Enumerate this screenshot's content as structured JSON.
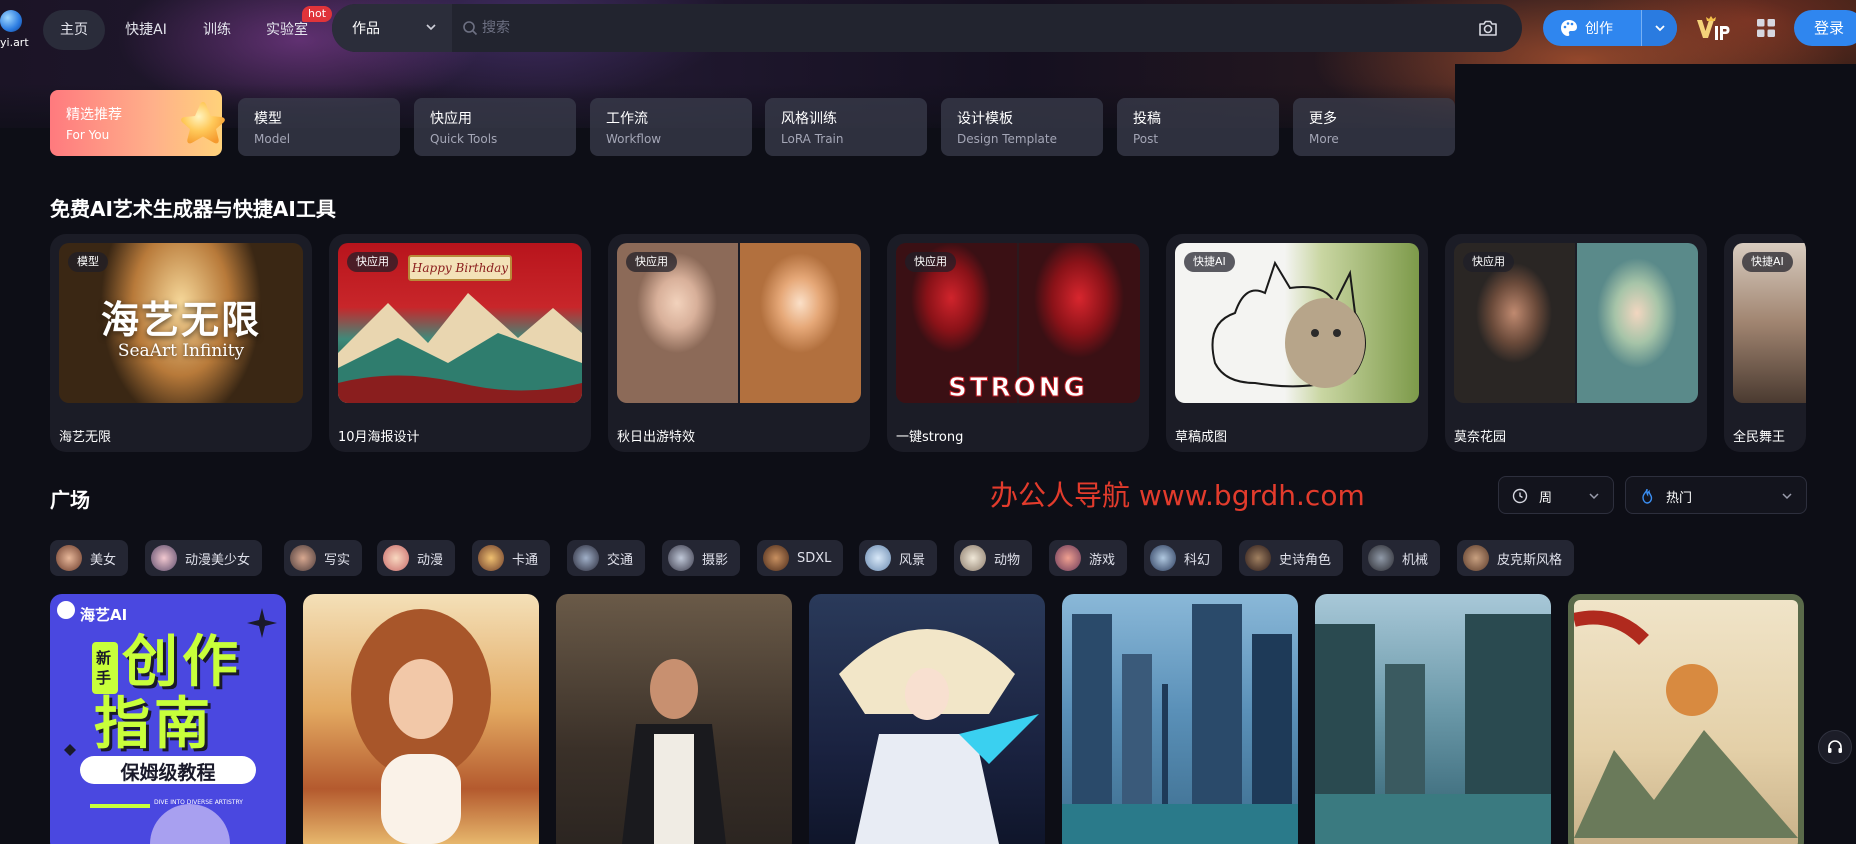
{
  "logo": {
    "text": "yi.art"
  },
  "nav": {
    "home": "主页",
    "quick_ai": "快捷AI",
    "train": "训练",
    "lab": "实验室",
    "hot_badge": "hot"
  },
  "search": {
    "category": "作品",
    "placeholder": "搜索"
  },
  "actions": {
    "create_label": "创作",
    "login_label": "登录",
    "vip_icon": "vip-crown-icon",
    "grid_icon": "apps-grid-icon"
  },
  "categories": [
    {
      "cn": "精选推荐",
      "en": "For You"
    },
    {
      "cn": "模型",
      "en": "Model"
    },
    {
      "cn": "快应用",
      "en": "Quick Tools"
    },
    {
      "cn": "工作流",
      "en": "Workflow"
    },
    {
      "cn": "风格训练",
      "en": "LoRA Train"
    },
    {
      "cn": "设计模板",
      "en": "Design Template"
    },
    {
      "cn": "投稿",
      "en": "Post"
    },
    {
      "cn": "更多",
      "en": "More"
    }
  ],
  "tools_section": {
    "title": "免费AI艺术生成器与快捷AI工具",
    "cards": [
      {
        "tag": "模型",
        "name": "海艺无限",
        "thumb_title": "海艺无限",
        "thumb_subtitle": "SeaArt Infinity"
      },
      {
        "tag": "快应用",
        "name": "10月海报设计",
        "thumb_banner": "Happy Birthday"
      },
      {
        "tag": "快应用",
        "name": "秋日出游特效"
      },
      {
        "tag": "快应用",
        "name": "一键strong",
        "thumb_caption": "STRONG"
      },
      {
        "tag": "快捷AI",
        "name": "草稿成图"
      },
      {
        "tag": "快应用",
        "name": "莫奈花园"
      },
      {
        "tag": "快捷AI",
        "name": "全民舞王"
      }
    ]
  },
  "watermark": "办公人导航 www.bgrdh.com",
  "plaza": {
    "title": "广场",
    "sort_period": "周",
    "sort_order": "热门",
    "tags": [
      "美女",
      "动漫美少女",
      "写实",
      "动漫",
      "卡通",
      "交通",
      "摄影",
      "SDXL",
      "风景",
      "动物",
      "游戏",
      "科幻",
      "史诗角色",
      "机械",
      "皮克斯风格"
    ],
    "feed": [
      {
        "brand": "海艺AI",
        "line1": "创作",
        "line2": "指南",
        "badge": "新手",
        "subtitle": "保姆级教程",
        "tagline": "DIVE INTO DIVERSE ARTISTRY"
      },
      {},
      {},
      {},
      {},
      {},
      {}
    ]
  },
  "colors": {
    "background": "#0d0e16",
    "accent_blue": "#2f86ef",
    "hot_red": "#e0343a",
    "watermark_red": "#e23b2c",
    "active_tab_gradient": [
      "#ff7a7e",
      "#ffd27a"
    ]
  }
}
